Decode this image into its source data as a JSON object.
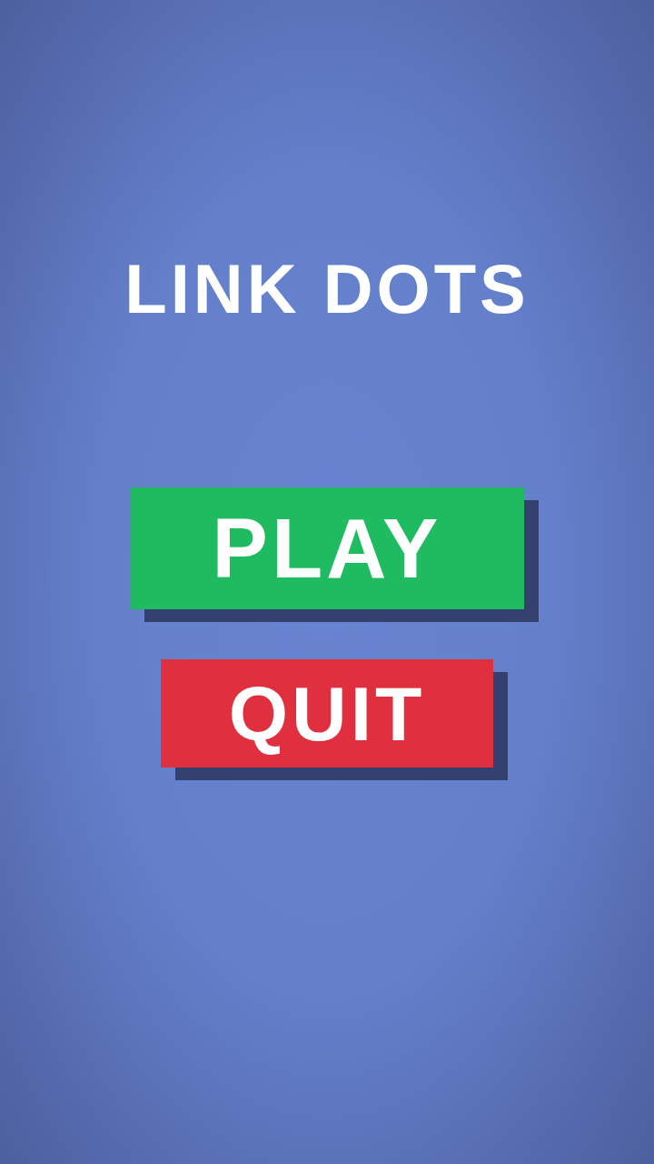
{
  "title": "LINK DOTS",
  "buttons": [
    {
      "label": "PLAY",
      "color": "#1fbb60"
    },
    {
      "label": "QUIT",
      "color": "#e0303f"
    }
  ]
}
